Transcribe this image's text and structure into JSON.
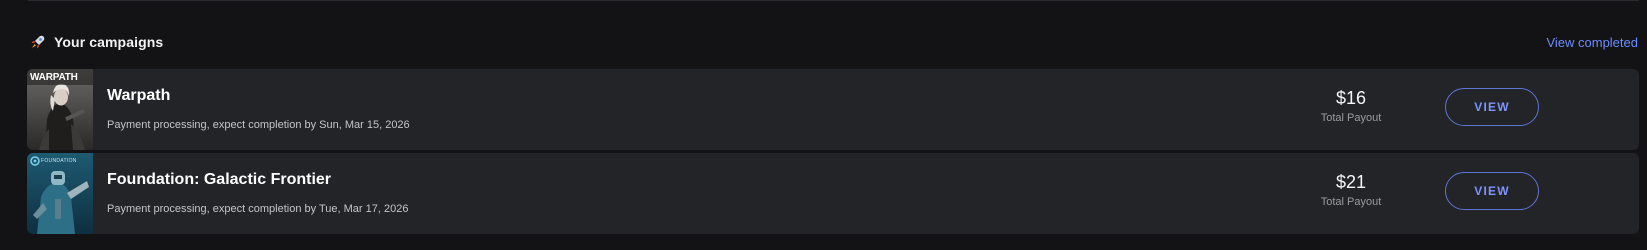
{
  "section": {
    "icon": "rocket-icon",
    "title": "Your campaigns",
    "view_completed_label": "View completed"
  },
  "campaigns": [
    {
      "thumbnail_icon": "warpath-cover-image",
      "thumbnail_logo_text": "WARPATH",
      "name": "Warpath",
      "status": "Payment processing, expect completion by Sun, Mar 15, 2026",
      "payout": "$16",
      "payout_label": "Total Payout",
      "button_label": "VIEW"
    },
    {
      "thumbnail_icon": "foundation-cover-image",
      "thumbnail_logo_text": "FOUNDATION",
      "name": "Foundation: Galactic Frontier",
      "status": "Payment processing, expect completion by Tue, Mar 17, 2026",
      "payout": "$21",
      "payout_label": "Total Payout",
      "button_label": "VIEW"
    }
  ],
  "colors": {
    "page_bg": "#131315",
    "card_bg": "#232427",
    "accent": "#6b8cff",
    "button_border": "#5b75d6"
  }
}
